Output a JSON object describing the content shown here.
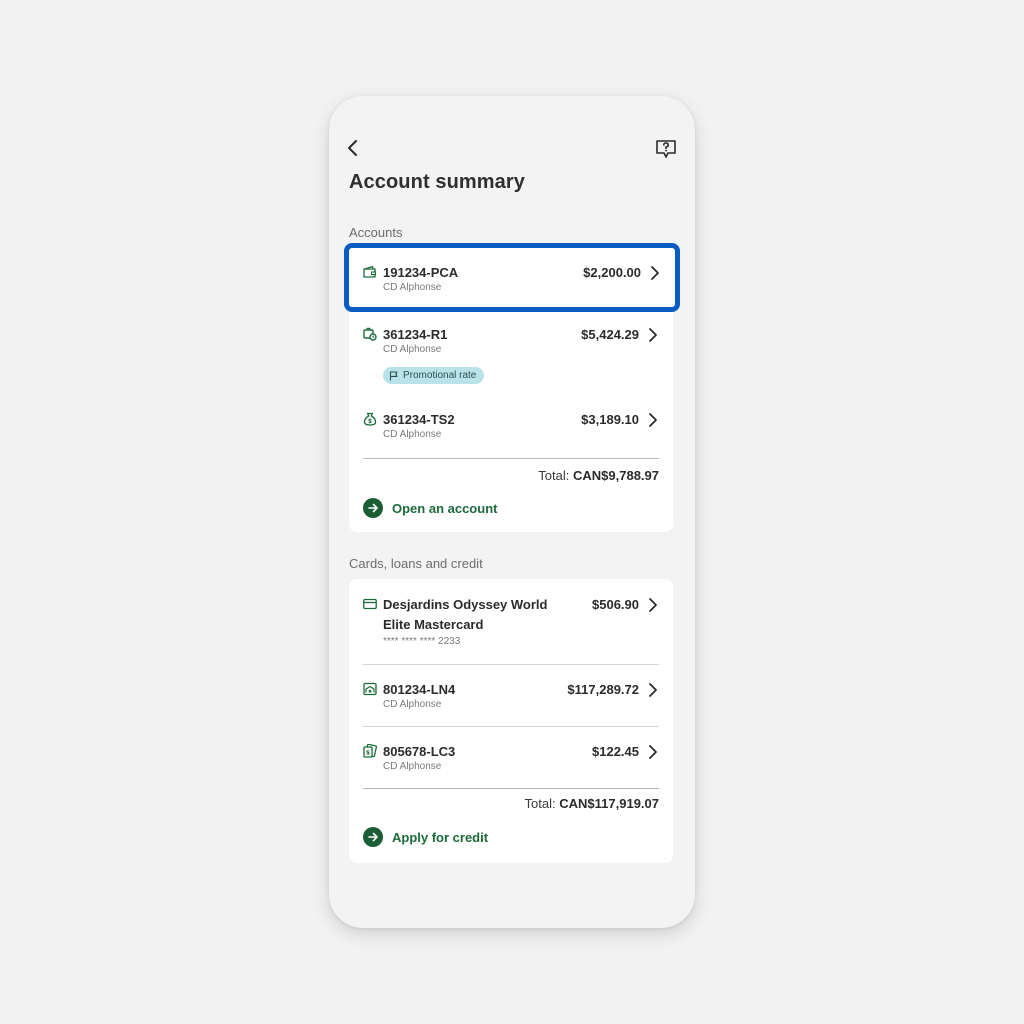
{
  "page_title": "Account summary",
  "accounts_section": {
    "label": "Accounts",
    "items": [
      {
        "name": "191234-PCA",
        "owner": "CD Alphonse",
        "amount": "$2,200.00",
        "icon": "wallet-icon",
        "highlighted": true
      },
      {
        "name": "361234-R1",
        "owner": "CD Alphonse",
        "amount": "$5,424.29",
        "icon": "savings-clock-icon",
        "badge": "Promotional rate"
      },
      {
        "name": "361234-TS2",
        "owner": "CD Alphonse",
        "amount": "$3,189.10",
        "icon": "money-bag-icon"
      }
    ],
    "total_label": "Total:",
    "total_value": "CAN$9,788.97",
    "action_label": "Open an account"
  },
  "credit_section": {
    "label": "Cards, loans and credit",
    "items": [
      {
        "name_line1": "Desjardins Odyssey World",
        "name_line2": "Elite Mastercard",
        "number": "**** **** **** 2233",
        "amount": "$506.90",
        "icon": "credit-card-icon"
      },
      {
        "name": "801234-LN4",
        "owner": "CD Alphonse",
        "amount": "$117,289.72",
        "icon": "loan-icon"
      },
      {
        "name": "805678-LC3",
        "owner": "CD Alphonse",
        "amount": "$122.45",
        "icon": "credit-line-icon"
      }
    ],
    "total_label": "Total:",
    "total_value": "CAN$117,919.07",
    "action_label": "Apply for credit"
  },
  "colors": {
    "accent_green": "#1b5e35",
    "highlight_blue": "#0a5bc2",
    "badge_bg": "#b9e3e8"
  }
}
